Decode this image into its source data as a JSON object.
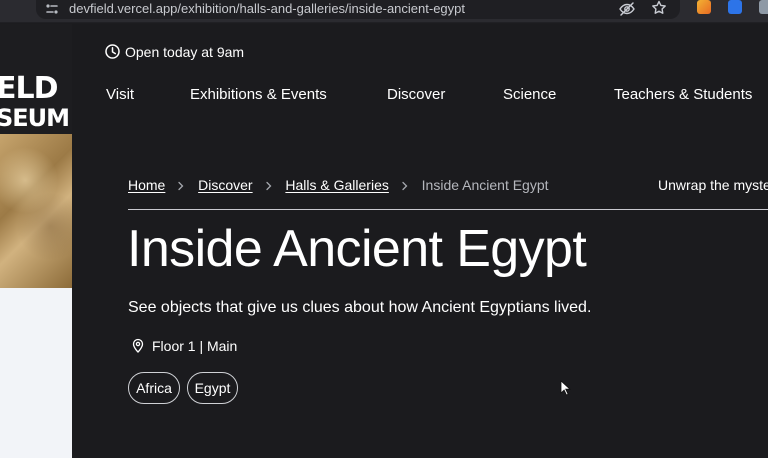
{
  "browser": {
    "url": "devfield.vercel.app/exhibition/halls-and-galleries/inside-ancient-egypt",
    "icons": [
      "site-info-icon",
      "eye-off-icon",
      "star-icon"
    ]
  },
  "site": {
    "logo": {
      "line1": "ELD",
      "line2": "SEUM"
    },
    "hours": "Open today at 9am",
    "nav": [
      "Visit",
      "Exhibitions & Events",
      "Discover",
      "Science",
      "Teachers & Students"
    ]
  },
  "breadcrumb": {
    "home": "Home",
    "discover": "Discover",
    "halls": "Halls & Galleries",
    "current": "Inside Ancient Egypt"
  },
  "side_tease": "Unwrap the myste",
  "page": {
    "title": "Inside Ancient Egypt",
    "description": "See objects that give us clues about how Ancient Egyptians lived.",
    "location": "Floor 1 | Main",
    "tags": [
      "Africa",
      "Egypt"
    ]
  },
  "colors": {
    "page_bg": "#1b1b1e",
    "text": "#ffffff",
    "muted": "#b5b7bd",
    "left_panel": "#f2f4f8"
  }
}
